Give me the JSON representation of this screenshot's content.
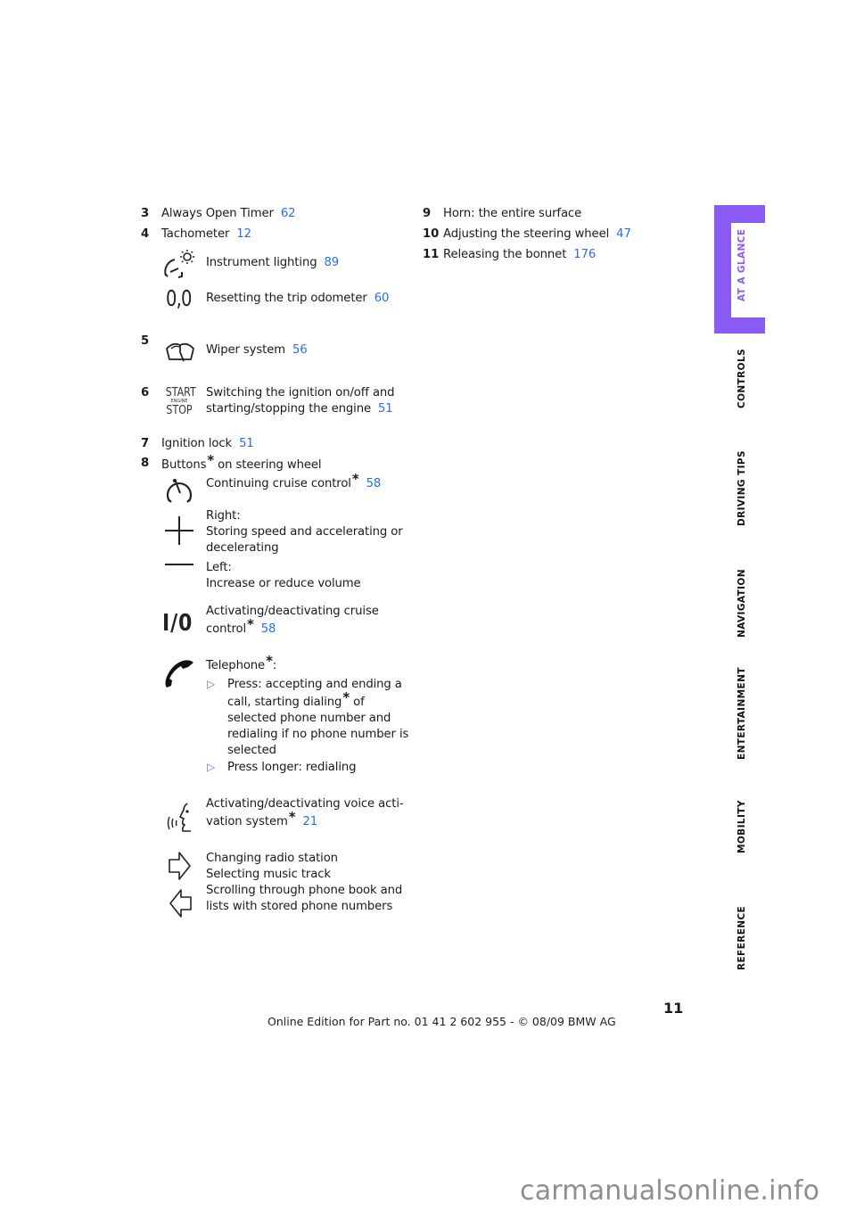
{
  "left_column": {
    "item3": {
      "num": "3",
      "label": "Always Open Timer",
      "page": "62"
    },
    "item4": {
      "num": "4",
      "label": "Tachometer",
      "page": "12",
      "sub": [
        {
          "icon": "instrument-lighting-icon",
          "label": "Instrument lighting",
          "page": "89"
        },
        {
          "icon": "trip-odometer-icon",
          "label": "Resetting the trip odometer",
          "page": "60",
          "glyph": "0,0"
        }
      ]
    },
    "item5": {
      "num": "5",
      "icon": "wiper-icon",
      "label": "Wiper system",
      "page": "56"
    },
    "item6": {
      "num": "6",
      "icon": "start-stop-icon",
      "icon_text": {
        "top": "START",
        "mid": "ENGINE",
        "bottom": "STOP"
      },
      "line1": "Switching the ignition on/off and",
      "line2": "starting/stopping the engine",
      "page": "51"
    },
    "item7": {
      "num": "7",
      "label": "Ignition lock",
      "page": "51"
    },
    "item8": {
      "num": "8",
      "label_pre": "Buttons",
      "star": "*",
      "label_post": " on steering wheel",
      "sub": {
        "cruise_continue": {
          "label": "Continuing cruise control",
          "star": "*",
          "page": "58"
        },
        "plus": {
          "line1": "Right:",
          "line2": "Storing speed and accelerating or",
          "line3": "decelerating"
        },
        "minus": {
          "line1": "Left:",
          "line2": "Increase or reduce volume"
        },
        "cruise_toggle": {
          "glyph": "I/0",
          "line1": "Activating/deactivating cruise",
          "line2": "control",
          "star": "*",
          "page": "58"
        },
        "telephone": {
          "label": "Telephone",
          "star": "*",
          "colon": ":",
          "bullet": "▷",
          "bullets": [
            {
              "lines": [
                "Press: accepting and ending a",
                "call, starting dialing",
                " of",
                "selected phone number and",
                "redialing if no phone number is",
                "selected"
              ]
            },
            {
              "lines": [
                "Press longer: redialing"
              ]
            }
          ]
        },
        "voice": {
          "line1": "Activating/deactivating voice acti-",
          "line2": "vation system",
          "star": "*",
          "page": "21"
        },
        "arrows": {
          "line1": "Changing radio station",
          "line2": "Selecting music track",
          "line3": "Scrolling through phone book and",
          "line4": "lists with stored phone numbers"
        }
      }
    }
  },
  "right_column": [
    {
      "num": "9",
      "label": "Horn: the entire surface",
      "page": ""
    },
    {
      "num": "10",
      "label": "Adjusting the steering wheel",
      "page": "47"
    },
    {
      "num": "11",
      "label": "Releasing the bonnet",
      "page": "176"
    }
  ],
  "side_tabs": [
    {
      "label": "AT A GLANCE",
      "active": true
    },
    {
      "label": "CONTROLS",
      "active": false
    },
    {
      "label": "DRIVING TIPS",
      "active": false
    },
    {
      "label": "NAVIGATION",
      "active": false
    },
    {
      "label": "ENTERTAINMENT",
      "active": false
    },
    {
      "label": "MOBILITY",
      "active": false
    },
    {
      "label": "REFERENCE",
      "active": false
    }
  ],
  "page_number": "11",
  "footer": "Online Edition for Part no. 01 41 2 602 955 - © 08/09 BMW AG",
  "watermark": "carmanualsonline.info",
  "colors": {
    "link": "#2b6cf0",
    "accent": "#8a5cf5",
    "text": "#1a1a1a"
  }
}
